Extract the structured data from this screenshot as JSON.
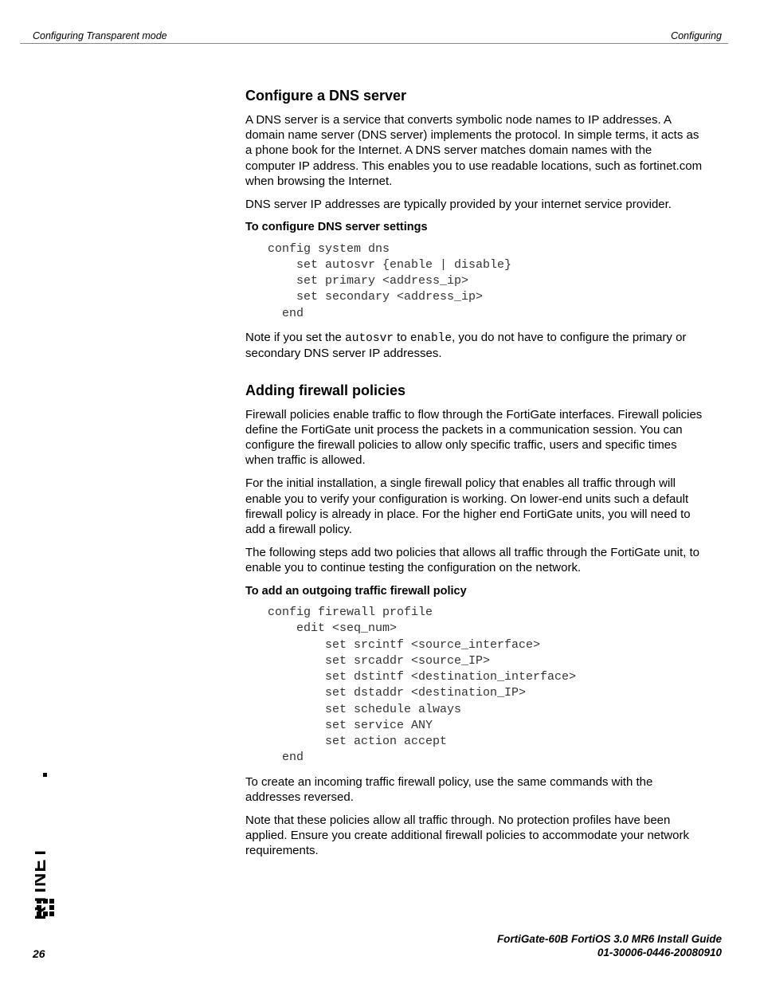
{
  "header": {
    "left": "Configuring Transparent mode",
    "right": "Configuring"
  },
  "section1": {
    "heading": "Configure a DNS server",
    "para1": "A DNS server is a service that converts symbolic node names to IP addresses. A domain name server (DNS server) implements the protocol. In simple terms, it acts as a phone book for the Internet. A DNS server matches domain names with the computer IP address. This enables you to use readable locations, such as fortinet.com when browsing the Internet.",
    "para2": "DNS server IP addresses are typically provided by your internet service provider.",
    "subhead": "To configure DNS server settings",
    "code": "config system dns\n    set autosvr {enable | disable}\n    set primary <address_ip>\n    set secondary <address_ip>\n  end",
    "note_pre": "Note if you set the ",
    "note_code1": "autosvr",
    "note_mid": " to ",
    "note_code2": "enable",
    "note_post": ", you do not have to configure the primary or secondary DNS server IP addresses."
  },
  "section2": {
    "heading": "Adding firewall policies",
    "para1": "Firewall policies enable traffic to flow through the FortiGate interfaces. Firewall policies define the FortiGate unit process the packets in a communication session. You can configure the firewall policies to allow only specific traffic, users and specific times when traffic is allowed.",
    "para2": "For the initial installation, a single firewall policy that enables all traffic through will enable you to verify your configuration is working. On lower-end units such a default firewall policy is already in place. For the higher end FortiGate units, you will need to add a firewall policy.",
    "para3": "The following steps add two policies that allows all traffic through the FortiGate unit, to enable you to continue testing the configuration on the network.",
    "subhead": "To add an outgoing traffic firewall policy",
    "code": "config firewall profile\n    edit <seq_num>\n        set srcintf <source_interface>\n        set srcaddr <source_IP>\n        set dstintf <destination_interface>\n        set dstaddr <destination_IP>\n        set schedule always\n        set service ANY\n        set action accept\n  end",
    "para4": "To create an incoming traffic firewall policy, use the same commands with the addresses reversed.",
    "para5": "Note that these policies allow all traffic through. No protection profiles have been applied. Ensure you create additional firewall policies to accommodate your network requirements."
  },
  "footer": {
    "line1": "FortiGate-60B FortiOS 3.0 MR6 Install Guide",
    "line2": "01-30006-0446-20080910",
    "page_number": "26"
  }
}
